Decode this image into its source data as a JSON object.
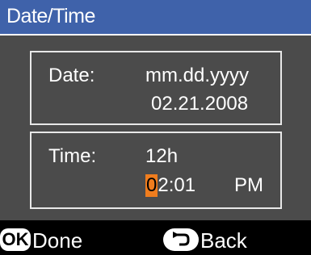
{
  "title": "Date/Time",
  "date": {
    "label": "Date:",
    "format": "mm.dd.yyyy",
    "value": "02.21.2008"
  },
  "time": {
    "label": "Time:",
    "format": "12h",
    "cursor_digit": "0",
    "value_rest": "2:01",
    "ampm": "PM"
  },
  "footer": {
    "ok_icon": "OK",
    "done_label": "Done",
    "back_label": "Back"
  },
  "colors": {
    "title_bar": "#3f62aa",
    "panel": "#4b4b4b",
    "cursor": "#f07d1e"
  },
  "icons": [
    "ok-button-icon",
    "back-arrow-icon"
  ]
}
